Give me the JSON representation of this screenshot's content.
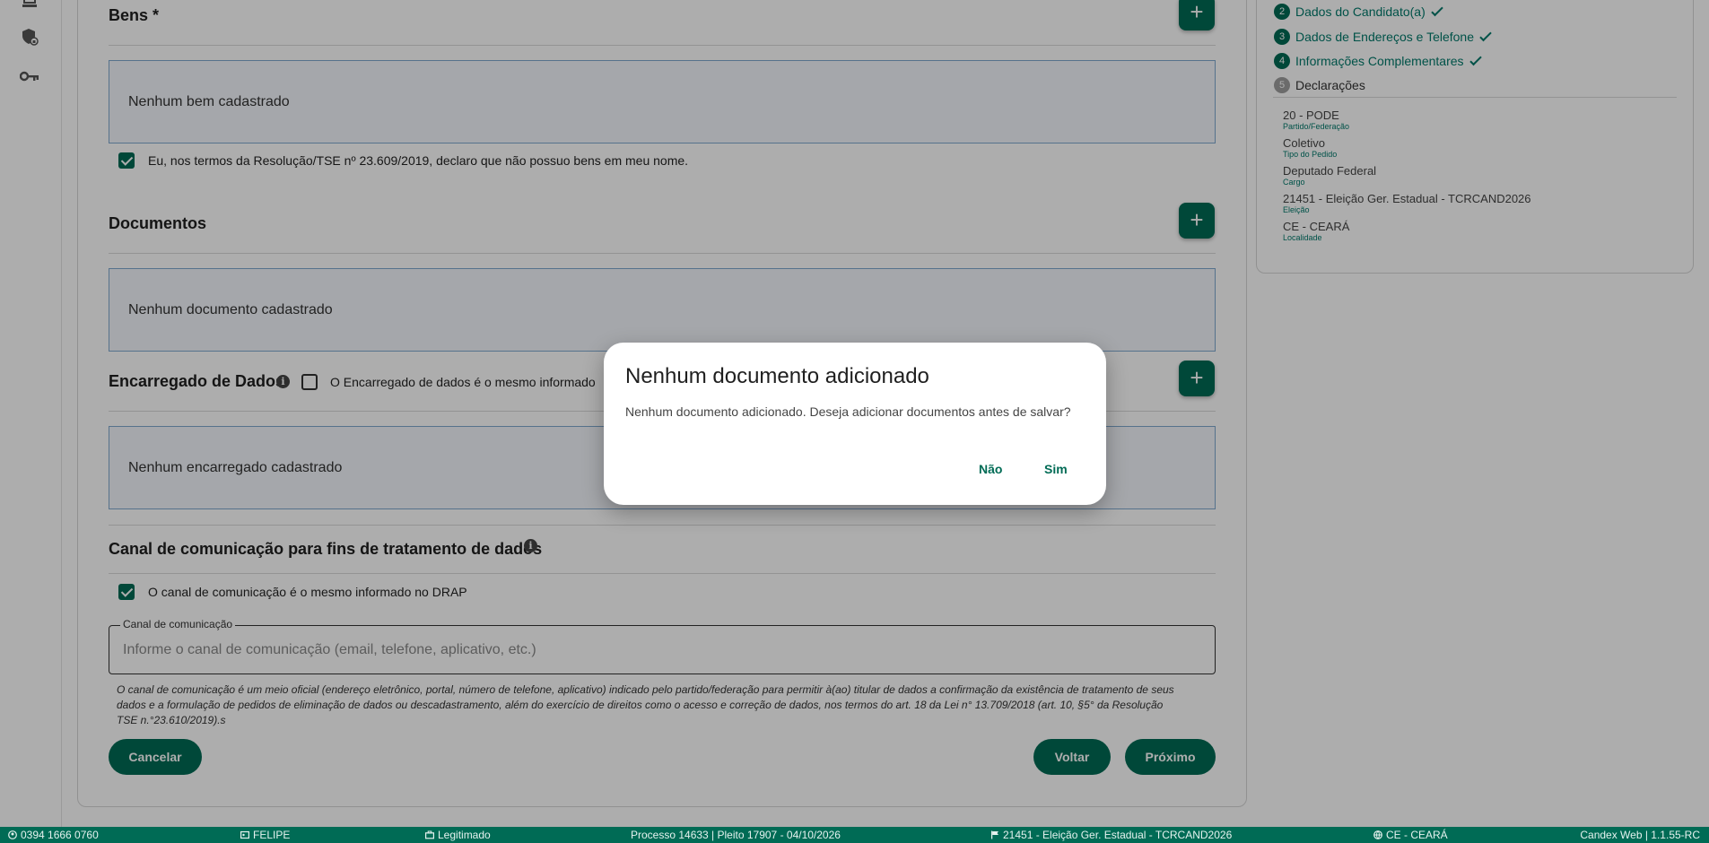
{
  "left_rail": {
    "icons": [
      "layers-icon",
      "shield-lock-icon",
      "key-icon"
    ]
  },
  "sections": {
    "bens": {
      "title": "Bens *",
      "empty": "Nenhum bem cadastrado",
      "declaration": "Eu, nos termos da Resolução/TSE nº 23.609/2019, declaro que não possuo bens em meu nome.",
      "declaration_checked": true
    },
    "documentos": {
      "title": "Documentos",
      "empty": "Nenhum documento cadastrado"
    },
    "encarregado": {
      "title": "Encarregado de Dados",
      "same_label": "O Encarregado de dados é o mesmo informado",
      "same_checked": false,
      "empty": "Nenhum encarregado cadastrado"
    },
    "canal": {
      "title": "Canal de comunicação para fins de tratamento de dados",
      "same_label": "O canal de comunicação é o mesmo informado no DRAP",
      "same_checked": true,
      "field_label": "Canal de comunicação",
      "field_placeholder": "Informe o canal de comunicação (email, telefone, aplicativo, etc.)",
      "hint": " O canal de comunicação é um meio oficial (endereço eletrônico, portal, número de telefone, aplicativo) indicado pelo partido/federação para permitir à(ao) titular de dados a confirmação da existência de tratamento de seus dados e a formulação de pedidos de eliminação de dados ou descadastramento, além do exercício de direitos como o acesso e correção de dados, nos termos do art. 18 da Lei n° 13.709/2018 (art. 10, §5° da Resolução TSE n.°23.610/2019).s"
    }
  },
  "actions": {
    "cancel": "Cancelar",
    "back": "Voltar",
    "next": "Próximo"
  },
  "stepper": {
    "steps": [
      {
        "num": "2",
        "label": "Dados do Candidato(a)",
        "done": true
      },
      {
        "num": "3",
        "label": "Dados de Endereços e Telefone",
        "done": true
      },
      {
        "num": "4",
        "label": "Informações Complementares",
        "done": true
      },
      {
        "num": "5",
        "label": "Declarações",
        "done": false
      }
    ]
  },
  "summary": [
    {
      "value": "20 - PODE",
      "caption": "Partido/Federação"
    },
    {
      "value": "Coletivo",
      "caption": "Tipo do Pedido"
    },
    {
      "value": "Deputado Federal",
      "caption": "Cargo"
    },
    {
      "value": "21451 - Eleição Ger. Estadual - TCRCAND2026",
      "caption": "Eleição"
    },
    {
      "value": "CE - CEARÁ",
      "caption": "Localidade"
    }
  ],
  "dialog": {
    "title": "Nenhum documento adicionado",
    "message": "Nenhum documento adicionado. Deseja adicionar documentos antes de salvar?",
    "no": "Não",
    "yes": "Sim"
  },
  "status_bar": {
    "cpf": "0394 1666 0760",
    "user": "FELIPE",
    "status": "Legitimado",
    "process": "Processo 14633 | Pleito 17907 - 04/10/2026",
    "election": "21451 - Eleição Ger. Estadual - TCRCAND2026",
    "locality": "CE - CEARÁ",
    "version": "Candex Web | 1.1.55-RC"
  },
  "colors": {
    "primary": "#006b55",
    "link": "#00796b",
    "empty_border": "#7fa9cf",
    "empty_bg": "#f3f7fc"
  }
}
